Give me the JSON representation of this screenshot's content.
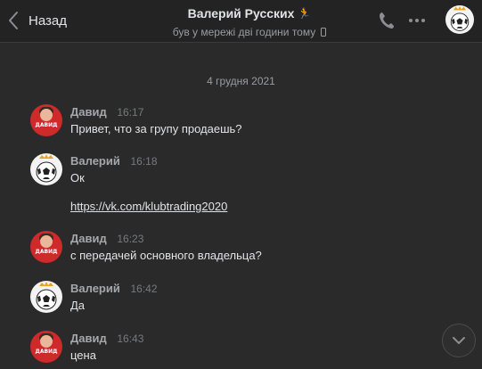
{
  "header": {
    "back_label": "Назад",
    "title": "Валерий Русских",
    "status": "був у мережі дві години тому",
    "icons": {
      "call": "phone-icon",
      "more": "more-icon",
      "device": "mobile-icon",
      "back": "chevron-left-icon"
    }
  },
  "date_separator": "4 грудня 2021",
  "messages": [
    {
      "name": "Давид",
      "time": "16:17",
      "text": "Привет, что за групу продаешь?",
      "avatar": "david"
    },
    {
      "name": "Валерий",
      "time": "16:18",
      "text": "Ок",
      "link": "https://vk.com/klubtrading2020",
      "avatar": "ball"
    },
    {
      "name": "Давид",
      "time": "16:23",
      "text": "с передачей основного владельца?",
      "avatar": "david"
    },
    {
      "name": "Валерий",
      "time": "16:42",
      "text": "Да",
      "avatar": "ball"
    },
    {
      "name": "Давид",
      "time": "16:43",
      "text": "цена",
      "avatar": "david"
    }
  ],
  "avatar_label": "ДАВИД",
  "colors": {
    "background": "#2a2a2a",
    "header": "#232323",
    "text": "#e1e3e6",
    "muted": "#9a9ca0",
    "david_avatar": "#cf2a2a"
  }
}
